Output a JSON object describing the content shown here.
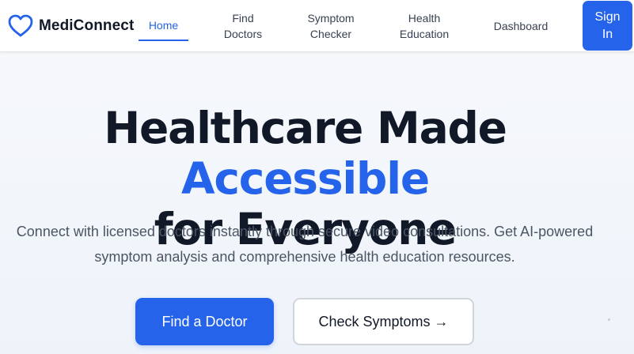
{
  "header": {
    "brand": "MediConnect",
    "logo_icon": "heart-icon",
    "nav": [
      {
        "line1": "Home",
        "line2": "",
        "active": true
      },
      {
        "line1": "Find",
        "line2": "Doctors",
        "active": false
      },
      {
        "line1": "Symptom",
        "line2": "Checker",
        "active": false
      },
      {
        "line1": "Health",
        "line2": "Education",
        "active": false
      },
      {
        "line1": "Dashboard",
        "line2": "",
        "active": false
      }
    ],
    "signin_line1": "Sign",
    "signin_line2": "In"
  },
  "hero": {
    "title_part1": "Healthcare Made ",
    "title_accent": "Accessible",
    "title_line2": "for Everyone",
    "subtitle_line1": "Connect with licensed doctors instantly through secure video consultations. Get AI-powered",
    "subtitle_line2": "symptom analysis and comprehensive health education resources.",
    "primary_button": "Find a Doctor",
    "secondary_button": "Check Symptoms →"
  },
  "colors": {
    "accent": "#2563eb",
    "heading": "#111827",
    "body_text": "#4b5563"
  }
}
